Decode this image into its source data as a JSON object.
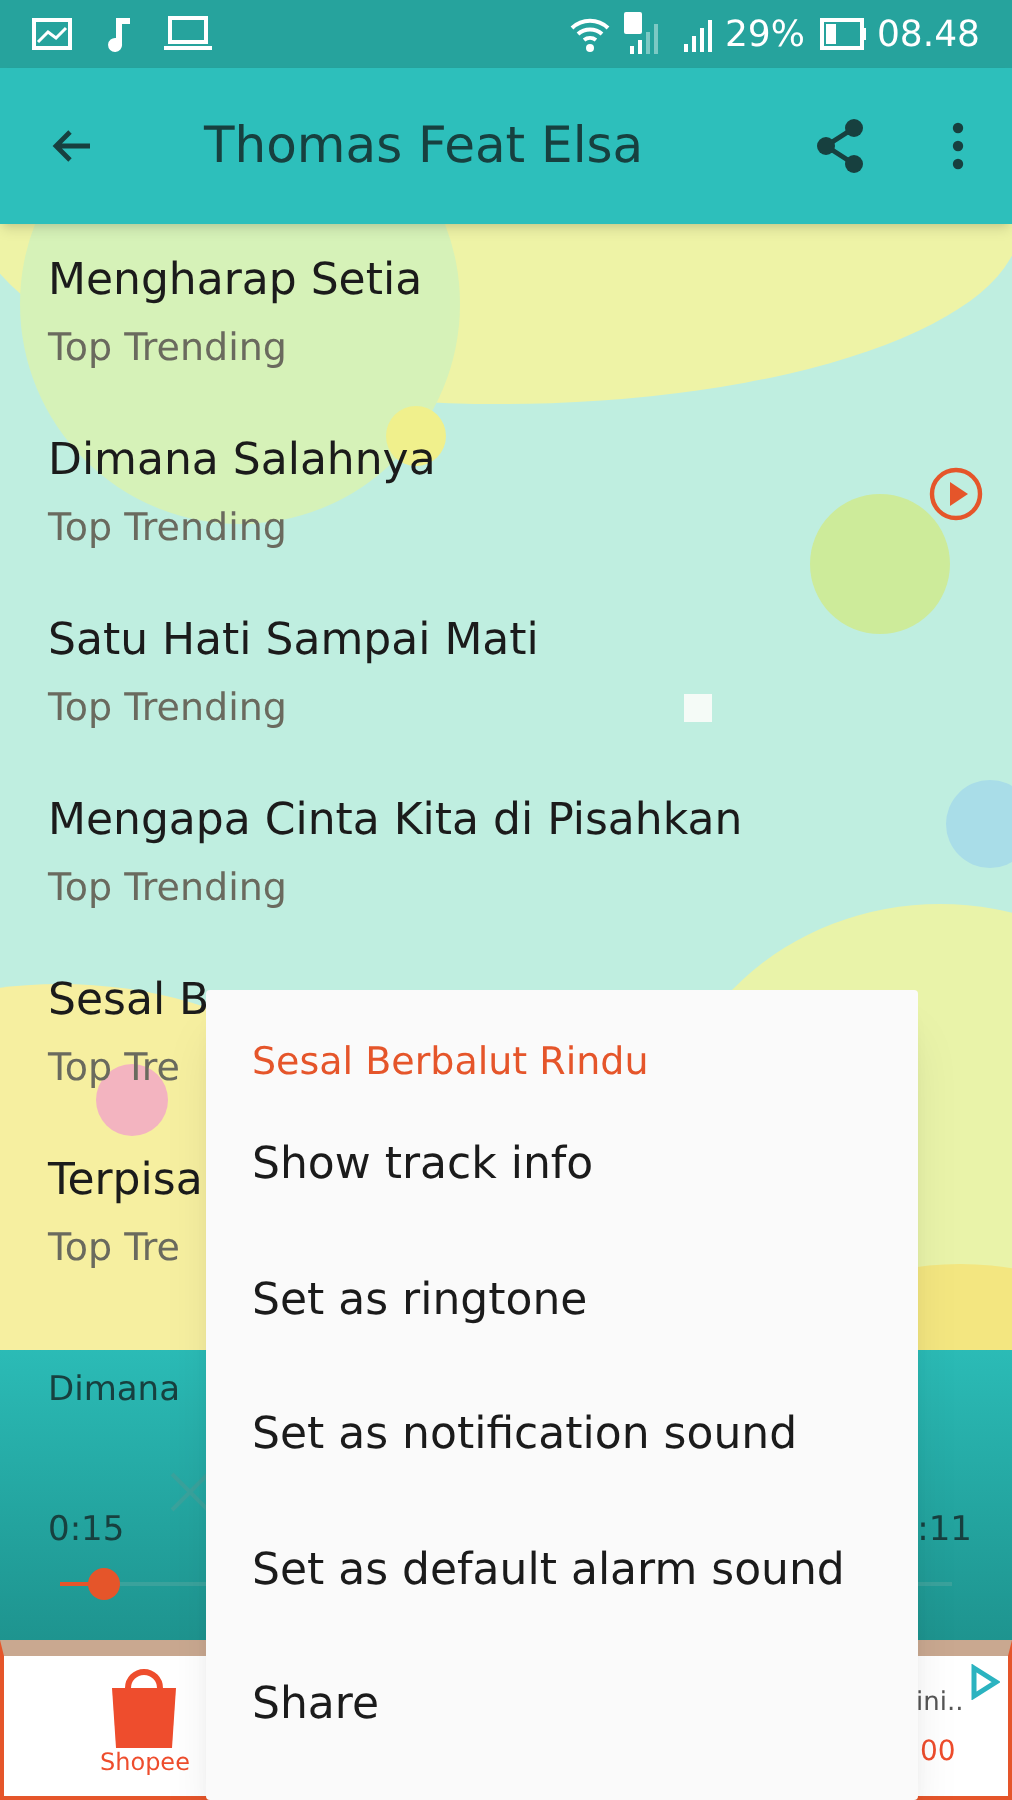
{
  "status_bar": {
    "battery": "29%",
    "time": "08.48"
  },
  "app_bar": {
    "title": "Thomas Feat Elsa"
  },
  "tracks": [
    {
      "title": "Mengharap Setia",
      "subtitle": "Top Trending",
      "playing": false
    },
    {
      "title": "Dimana Salahnya",
      "subtitle": "Top Trending",
      "playing": true
    },
    {
      "title": "Satu Hati Sampai Mati",
      "subtitle": "Top Trending",
      "playing": false
    },
    {
      "title": "Mengapa Cinta Kita di Pisahkan",
      "subtitle": "Top Trending",
      "playing": false
    },
    {
      "title": "Sesal B",
      "subtitle": "Top Tre",
      "playing": false
    },
    {
      "title": "Terpisa",
      "subtitle": "Top Tre",
      "playing": false
    }
  ],
  "player": {
    "title": "Dimana",
    "elapsed": "0:15",
    "total": ":11",
    "level": 0.05
  },
  "ad": {
    "brand": "Shopee",
    "line_1": "ini..",
    "line_2": "00"
  },
  "context_menu": {
    "title": "Sesal Berbalut Rindu",
    "items": [
      "Show track info",
      "Set as ringtone",
      "Set as notification sound",
      "Set as default alarm sound",
      "Share"
    ]
  }
}
